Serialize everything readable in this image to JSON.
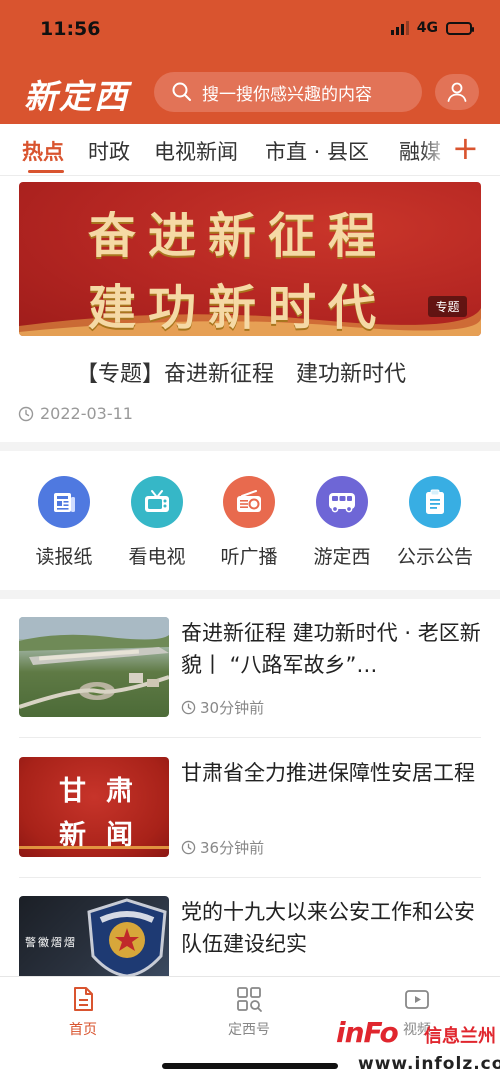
{
  "status_bar": {
    "time": "11:56",
    "network": "4G",
    "battery_level": 0.45
  },
  "header": {
    "logo_text": "新定西",
    "search_placeholder": "搜一搜你感兴趣的内容",
    "brand_color": "#d9542f"
  },
  "tabs": [
    {
      "label": "热点",
      "active": true
    },
    {
      "label": "时政"
    },
    {
      "label": "电视新闻"
    },
    {
      "label": "市直 · 县区"
    },
    {
      "label": "融媒"
    }
  ],
  "banner": {
    "line1": "奋进新征程",
    "line2": "建功新时代",
    "tag": "专题"
  },
  "feature": {
    "title": "【专题】奋进新征程　建功新时代",
    "date": "2022-03-11"
  },
  "shortcuts": [
    {
      "label": "读报纸",
      "icon": "newspaper-icon",
      "color": "#4f79e0"
    },
    {
      "label": "看电视",
      "icon": "tv-icon",
      "color": "#36b7c7"
    },
    {
      "label": "听广播",
      "icon": "radio-icon",
      "color": "#e86a4e"
    },
    {
      "label": "游定西",
      "icon": "bus-icon",
      "color": "#6e66d6"
    },
    {
      "label": "公示公告",
      "icon": "clipboard-icon",
      "color": "#38aee3"
    }
  ],
  "news": [
    {
      "title": "奋进新征程 建功新时代 · 老区新貌丨 “八路军故乡”…",
      "time": "30分钟前",
      "thumb": "aerial-photo"
    },
    {
      "title": "甘肃省全力推进保障性安居工程",
      "time": "36分钟前",
      "thumb": "gansu-news",
      "thumb_text_1": "甘肃",
      "thumb_text_2": "新闻"
    },
    {
      "title": "党的十九大以来公安工作和公安队伍建设纪实",
      "time": "",
      "thumb": "police-badge",
      "thumb_text": "警徽熠熠"
    }
  ],
  "bottom_nav": [
    {
      "label": "首页",
      "icon": "home-doc-icon",
      "active": true
    },
    {
      "label": "定西号",
      "icon": "grid-search-icon"
    },
    {
      "label": "视频",
      "icon": "video-play-icon"
    }
  ],
  "watermark": {
    "brand": "inFo",
    "name": "信息兰州",
    "url": "www.infolz.com"
  }
}
